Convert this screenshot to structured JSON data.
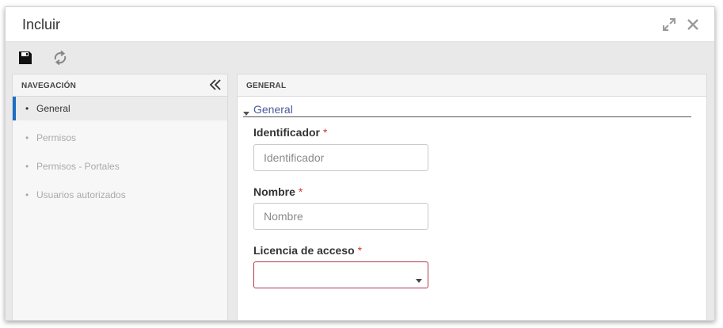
{
  "window": {
    "title": "Incluir",
    "maximize_icon": "expand-arrows-icon",
    "close_icon": "close-icon"
  },
  "toolbar": {
    "save_icon": "floppy-disk-icon",
    "refresh_icon": "refresh-icon"
  },
  "navigation": {
    "header": "NAVEGACIÓN",
    "collapse_icon": "double-chevron-left-icon",
    "items": [
      {
        "label": "General",
        "active": true
      },
      {
        "label": "Permisos",
        "active": false
      },
      {
        "label": "Permisos - Portales",
        "active": false
      },
      {
        "label": "Usuarios autorizados",
        "active": false
      }
    ]
  },
  "content": {
    "header": "GENERAL",
    "section_title": "General",
    "fields": {
      "identificador": {
        "label": "Identificador",
        "required_mark": "*",
        "value": "",
        "placeholder": "Identificador"
      },
      "nombre": {
        "label": "Nombre",
        "required_mark": "*",
        "value": "",
        "placeholder": "Nombre"
      },
      "licencia": {
        "label": "Licencia de acceso",
        "required_mark": "*",
        "value": ""
      }
    }
  },
  "colors": {
    "accent": "#1a6fc4",
    "required": "#d9342b",
    "invalid_border": "#b3364a",
    "section_link": "#4a5a9a"
  }
}
